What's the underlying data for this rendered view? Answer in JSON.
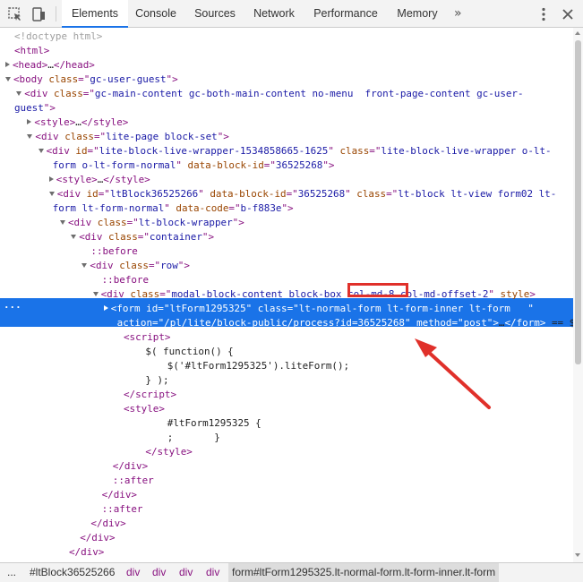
{
  "toolbar": {
    "tabs": [
      "Elements",
      "Console",
      "Sources",
      "Network",
      "Performance",
      "Memory"
    ],
    "more": "»",
    "active": "Elements"
  },
  "tree": [
    {
      "depth": 0,
      "html": "<span class='cm'>&lt;!doctype html&gt;</span>"
    },
    {
      "depth": 0,
      "html": "<span class='tag'>&lt;html&gt;</span>"
    },
    {
      "depth": 0,
      "tri": "r",
      "html": "<span class='tag'>&lt;head&gt;</span>…<span class='tag'>&lt;/head&gt;</span>"
    },
    {
      "depth": 0,
      "tri": "d",
      "html": "<span class='tag'>&lt;body</span> <span class='an'>class</span><span class='tag'>=\"</span><span class='av'>gc-user-guest</span><span class='tag'>\"&gt;</span>"
    },
    {
      "depth": 1,
      "tri": "d",
      "html": "<span class='tag'>&lt;div</span> <span class='an'>class</span><span class='tag'>=\"</span><span class='av'>gc-main-content gc-both-main-content no-menu  front-page-content gc-user-</span>"
    },
    {
      "depth": -1,
      "html": "<span class='av'>guest</span><span class='tag'>\"&gt;</span>"
    },
    {
      "depth": 2,
      "tri": "r",
      "html": "<span class='tag'>&lt;style&gt;</span>…<span class='tag'>&lt;/style&gt;</span>"
    },
    {
      "depth": 2,
      "tri": "d",
      "html": "<span class='tag'>&lt;div</span> <span class='an'>class</span><span class='tag'>=\"</span><span class='av'>lite-page block-set</span><span class='tag'>\"&gt;</span>"
    },
    {
      "depth": 3,
      "tri": "d",
      "html": "<span class='tag'>&lt;div</span> <span class='an'>id</span><span class='tag'>=\"</span><span class='av'>lite-block-live-wrapper-1534858665-1625</span><span class='tag'>\"</span> <span class='an'>class</span><span class='tag'>=\"</span><span class='av'>lite-block-live-wrapper o-lt-</span>"
    },
    {
      "depth": 3.5,
      "html": "<span class='av'>form o-lt-form-normal</span><span class='tag'>\"</span> <span class='an'>data-block-id</span><span class='tag'>=\"</span><span class='av'>36525268</span><span class='tag'>\"&gt;</span>"
    },
    {
      "depth": 4,
      "tri": "r",
      "html": "<span class='tag'>&lt;style&gt;</span>…<span class='tag'>&lt;/style&gt;</span>"
    },
    {
      "depth": 4,
      "tri": "d",
      "html": "<span class='tag'>&lt;div</span> <span class='an'>id</span><span class='tag'>=\"</span><span class='av'>ltBlock36525266</span><span class='tag'>\"</span> <span class='an'>data-block-id</span><span class='tag'>=\"</span><span class='av'>36525268</span><span class='tag'>\"</span> <span class='an'>class</span><span class='tag'>=\"</span><span class='av'>lt-block lt-view form02 lt-</span>"
    },
    {
      "depth": 3.5,
      "html": "<span class='av'>form lt-form-normal</span><span class='tag'>\"</span> <span class='an'>data-code</span><span class='tag'>=\"</span><span class='av'>b-f883e</span><span class='tag'>\"&gt;</span>"
    },
    {
      "depth": 5,
      "tri": "d",
      "html": "<span class='tag'>&lt;div</span> <span class='an'>class</span><span class='tag'>=\"</span><span class='av'>lt-block-wrapper</span><span class='tag'>\"&gt;</span>"
    },
    {
      "depth": 6,
      "tri": "d",
      "html": "<span class='tag'>&lt;div</span> <span class='an'>class</span><span class='tag'>=\"</span><span class='av'>container</span><span class='tag'>\"&gt;</span>"
    },
    {
      "depth": 7,
      "html": "<span class='pseudo'>::before</span>"
    },
    {
      "depth": 7,
      "tri": "d",
      "html": "<span class='tag'>&lt;div</span> <span class='an'>class</span><span class='tag'>=\"</span><span class='av'>row</span><span class='tag'>\"&gt;</span>"
    },
    {
      "depth": 8,
      "html": "<span class='pseudo'>::before</span>"
    },
    {
      "depth": 8,
      "tri": "d",
      "html": "<span class='tag'>&lt;div</span> <span class='an'>class</span><span class='tag'>=\"</span><span class='av'>modal-block-content block-box col-md-8 col-md-offset-2</span><span class='tag'>\"</span> <span class='an'>style</span><span class='tag'>&gt;</span>"
    },
    {
      "depth": 9,
      "tri": "r",
      "selected": true,
      "html": "<span class='tag'>&lt;form</span> <span class='an'>id</span><span class='tag'>=\"</span><span class='av'>ltForm1295325</span><span class='tag'>\"</span> <span class='an'>class</span><span class='tag'>=\"</span><span class='av'>lt-normal-form lt-form-inner lt-form</span>   <span class='tag'>\"</span>"
    },
    {
      "depth": 9.4,
      "selected": true,
      "html": "<span class='an'>action</span><span class='tag'>=\"</span><span class='av'>/pl/lite/block-public/process?id=36525268</span><span class='tag'>\"</span> <span class='an'>method</span><span class='tag'>=\"</span><span class='av'>post</span><span class='tag'>\"&gt;</span>…<span class='tag'>&lt;/form&gt;</span> == $0"
    },
    {
      "depth": 10,
      "html": "<span class='tag'>&lt;script&gt;</span>"
    },
    {
      "depth": 12,
      "html": "$( function() {"
    },
    {
      "depth": 14,
      "html": "$('#ltForm1295325').liteForm();"
    },
    {
      "depth": 12,
      "html": "} );"
    },
    {
      "depth": 10,
      "html": "<span class='tag'>&lt;/script&gt;</span>"
    },
    {
      "depth": 10,
      "html": "<span class='tag'>&lt;style&gt;</span>"
    },
    {
      "depth": 14,
      "html": "#ltForm1295325 {"
    },
    {
      "depth": 14,
      "html": ";       }"
    },
    {
      "depth": 12,
      "html": "<span class='tag'>&lt;/style&gt;</span>"
    },
    {
      "depth": 9,
      "html": "<span class='tag'>&lt;/div&gt;</span>"
    },
    {
      "depth": 9,
      "html": "<span class='pseudo'>::after</span>"
    },
    {
      "depth": 8,
      "html": "<span class='tag'>&lt;/div&gt;</span>"
    },
    {
      "depth": 8,
      "html": "<span class='pseudo'>::after</span>"
    },
    {
      "depth": 7,
      "html": "<span class='tag'>&lt;/div&gt;</span>"
    },
    {
      "depth": 6,
      "html": "<span class='tag'>&lt;/div&gt;</span>"
    },
    {
      "depth": 5,
      "html": "<span class='tag'>&lt;/div&gt;</span>"
    },
    {
      "depth": 4,
      "html": "<span class='tag'>&lt;/div&gt;</span>"
    }
  ],
  "selection_dots": "...",
  "breadcrumbs": {
    "dots": "...",
    "items": [
      "#ltBlock36525266",
      "div",
      "div",
      "div",
      "div"
    ],
    "current": "form#ltForm1295325.lt-normal-form.lt-form-inner.lt-form"
  },
  "colors": {
    "selection": "#1a73e8",
    "highlight": "#e0302a",
    "tag": "#881280",
    "attr_name": "#994500",
    "attr_value": "#1a1aa6"
  },
  "icons": [
    "inspect-icon",
    "device-toggle-icon",
    "more-tabs-icon",
    "kebab-menu-icon",
    "close-icon"
  ]
}
